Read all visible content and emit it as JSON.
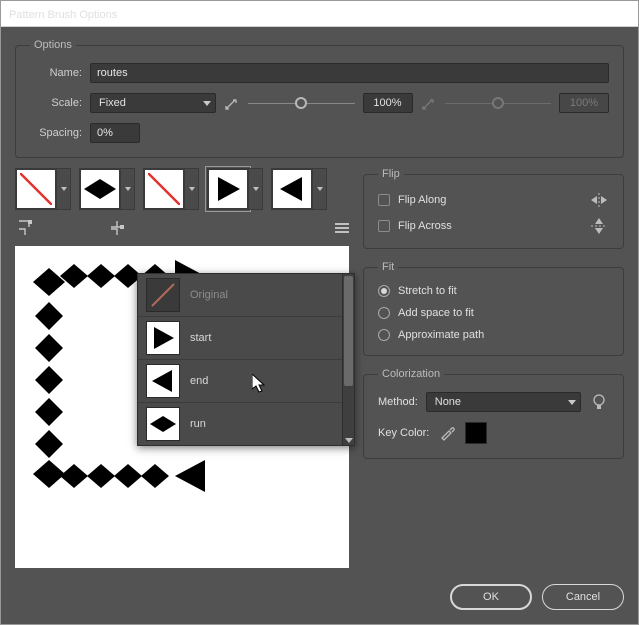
{
  "window": {
    "title": "Pattern Brush Options"
  },
  "options": {
    "legend": "Options",
    "name_label": "Name:",
    "name_value": "routes",
    "scale_label": "Scale:",
    "scale_mode": "Fixed",
    "scale_value": "100%",
    "scale_value2": "100%",
    "spacing_label": "Spacing:",
    "spacing_value": "0%"
  },
  "tiles": {
    "items": [
      {
        "name": "side-tile",
        "kind": "none"
      },
      {
        "name": "outer-corner-tile",
        "kind": "diamond"
      },
      {
        "name": "inner-corner-tile",
        "kind": "none"
      },
      {
        "name": "start-tile",
        "kind": "tri-right",
        "selected": true
      },
      {
        "name": "end-tile",
        "kind": "tri-left"
      }
    ]
  },
  "popup": {
    "items": [
      {
        "label": "Original",
        "kind": "slash",
        "dim": true
      },
      {
        "label": "start",
        "kind": "tri-right"
      },
      {
        "label": "end",
        "kind": "tri-left"
      },
      {
        "label": "run",
        "kind": "diamond"
      }
    ]
  },
  "flip": {
    "legend": "Flip",
    "along": "Flip Along",
    "across": "Flip Across"
  },
  "fit": {
    "legend": "Fit",
    "stretch": "Stretch to fit",
    "addspace": "Add space to fit",
    "approx": "Approximate path",
    "selected": "stretch"
  },
  "colorization": {
    "legend": "Colorization",
    "method_label": "Method:",
    "method_value": "None",
    "keycolor_label": "Key Color:",
    "keycolor_hex": "#000000"
  },
  "buttons": {
    "ok": "OK",
    "cancel": "Cancel"
  }
}
